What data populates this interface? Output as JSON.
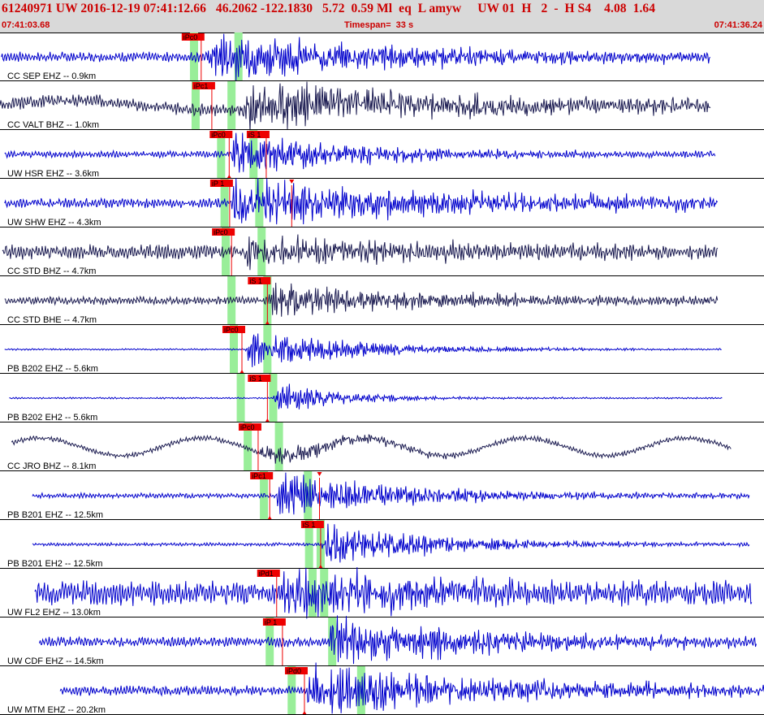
{
  "header": {
    "title": "61240971 UW 2016-12-19 07:41:12.66   46.2062 -122.1830   5.72  0.59 Ml  eq  L amyw     UW 01  H   2  -  H S4    4.08  1.64",
    "start_time": "07:41:03.68",
    "timespan": "Timespan=  33 s",
    "end_time": "07:41:36.24"
  },
  "colors": {
    "header_bg": "#d9d9d9",
    "header_text": "#cc0000",
    "trace_blue": "#0000cc",
    "trace_dark": "#1a1a50",
    "window_green": "#99ee99",
    "pick_red": "#ee0000"
  },
  "traces": [
    {
      "label": "CC SEP EHZ -- 0.9km",
      "color": "blue",
      "picks": [
        {
          "label": "iPc0",
          "t": 8.69,
          "marker": "none"
        }
      ],
      "windows": [
        8.38,
        10.3
      ],
      "start": 0.06,
      "end": 30.7,
      "onset": 9.0,
      "amp": 0.45,
      "noise": 0.06,
      "decay": 9
    },
    {
      "label": "CC VALT BHZ -- 1.0km",
      "color": "dark",
      "picks": [
        {
          "label": "iPc1",
          "t": 9.15,
          "marker": "none"
        }
      ],
      "windows": [
        8.45,
        10.0
      ],
      "start": 0.0,
      "end": 30.7,
      "onset": 10.4,
      "amp": 0.45,
      "noise": 0.08,
      "decay": 10
    },
    {
      "label": "UW HSR EHZ -- 3.6km",
      "color": "blue",
      "picks": [
        {
          "label": "iPc0",
          "t": 9.9,
          "marker": "bottom"
        },
        {
          "label": "iS 1",
          "t": 11.5,
          "marker": "top"
        }
      ],
      "windows": [
        9.55,
        10.95
      ],
      "start": 0.2,
      "end": 30.9,
      "onset": 10.0,
      "amp": 0.38,
      "noise": 0.04,
      "decay": 6
    },
    {
      "label": "UW SHW EHZ -- 4.3km",
      "color": "blue",
      "picks": [
        {
          "label": "iP 1",
          "t": 9.92,
          "marker": "none"
        },
        {
          "label": "",
          "t": 12.6,
          "marker": "top"
        }
      ],
      "windows": [
        9.7,
        11.2
      ],
      "start": 0.2,
      "end": 31.0,
      "onset": 10.0,
      "amp": 0.42,
      "noise": 0.06,
      "decay": 12
    },
    {
      "label": "CC STD BHZ -- 4.7km",
      "color": "dark",
      "picks": [
        {
          "label": "iPc0",
          "t": 10.0,
          "marker": "none"
        }
      ],
      "windows": [
        9.75,
        11.3
      ],
      "start": 0.1,
      "end": 31.0,
      "onset": 10.5,
      "amp": 0.3,
      "noise": 0.09,
      "decay": 8
    },
    {
      "label": "CC STD BHE -- 4.7km",
      "color": "dark",
      "picks": [
        {
          "label": "iS 1",
          "t": 11.55,
          "marker": "bottom"
        }
      ],
      "windows": [
        10.0,
        11.55
      ],
      "start": 0.2,
      "end": 31.0,
      "onset": 11.6,
      "amp": 0.32,
      "noise": 0.05,
      "decay": 7
    },
    {
      "label": "PB B202 EHZ -- 5.6km",
      "color": "blue",
      "picks": [
        {
          "label": "iPc0",
          "t": 10.45,
          "marker": "bottom"
        }
      ],
      "windows": [
        10.1,
        11.55
      ],
      "start": 0.2,
      "end": 31.2,
      "onset": 10.6,
      "amp": 0.35,
      "noise": 0.01,
      "decay": 5
    },
    {
      "label": "PB B202 EH2 -- 5.6km",
      "color": "blue",
      "picks": [
        {
          "label": "iS 1",
          "t": 11.55,
          "marker": "bottom"
        }
      ],
      "windows": [
        10.4,
        11.8
      ],
      "start": 0.4,
      "end": 31.2,
      "onset": 11.8,
      "amp": 0.28,
      "noise": 0.01,
      "decay": 3
    },
    {
      "label": "CC JRO BHZ -- 8.1km",
      "color": "dark",
      "picks": [
        {
          "label": "iPc0",
          "t": 11.15,
          "marker": "none"
        }
      ],
      "windows": [
        10.7,
        12.05
      ],
      "start": 0.5,
      "end": 31.6,
      "onset": 11.2,
      "amp": 0.22,
      "noise": 0.03,
      "decay": 4
    },
    {
      "label": "PB B201 EHZ -- 12.5km",
      "color": "blue",
      "picks": [
        {
          "label": "iPc1",
          "t": 11.65,
          "marker": "bottom"
        },
        {
          "label": "",
          "t": 13.8,
          "marker": "top"
        }
      ],
      "windows": [
        11.4,
        13.3
      ],
      "start": 1.4,
      "end": 32.4,
      "onset": 11.9,
      "amp": 0.4,
      "noise": 0.03,
      "decay": 6
    },
    {
      "label": "PB B201 EH2 -- 12.5km",
      "color": "blue",
      "picks": [
        {
          "label": "iS 1",
          "t": 13.85,
          "marker": "bottom"
        }
      ],
      "windows": [
        13.35,
        13.85
      ],
      "start": 1.4,
      "end": 32.4,
      "onset": 13.9,
      "amp": 0.42,
      "noise": 0.02,
      "decay": 5
    },
    {
      "label": "UW FL2 EHZ -- 13.0km",
      "color": "blue",
      "picks": [
        {
          "label": "iPd1",
          "t": 11.95,
          "marker": "top"
        }
      ],
      "windows": [
        13.5,
        14.0
      ],
      "start": 1.5,
      "end": 32.5,
      "onset": 12.1,
      "amp": 0.42,
      "noise": 0.15,
      "decay": 8
    },
    {
      "label": "UW CDF EHZ -- 14.5km",
      "color": "blue",
      "picks": [
        {
          "label": "iP 1",
          "t": 12.2,
          "marker": "none"
        }
      ],
      "windows": [
        11.65,
        14.35
      ],
      "start": 1.7,
      "end": 32.7,
      "onset": 14.2,
      "amp": 0.45,
      "noise": 0.06,
      "decay": 8
    },
    {
      "label": "UW MTM EHZ -- 20.2km",
      "color": "blue",
      "picks": [
        {
          "label": "iPd0",
          "t": 13.15,
          "marker": "bottom"
        }
      ],
      "windows": [
        12.6,
        15.6
      ],
      "start": 2.6,
      "end": 33.5,
      "onset": 13.2,
      "amp": 0.45,
      "noise": 0.06,
      "decay": 10
    }
  ]
}
